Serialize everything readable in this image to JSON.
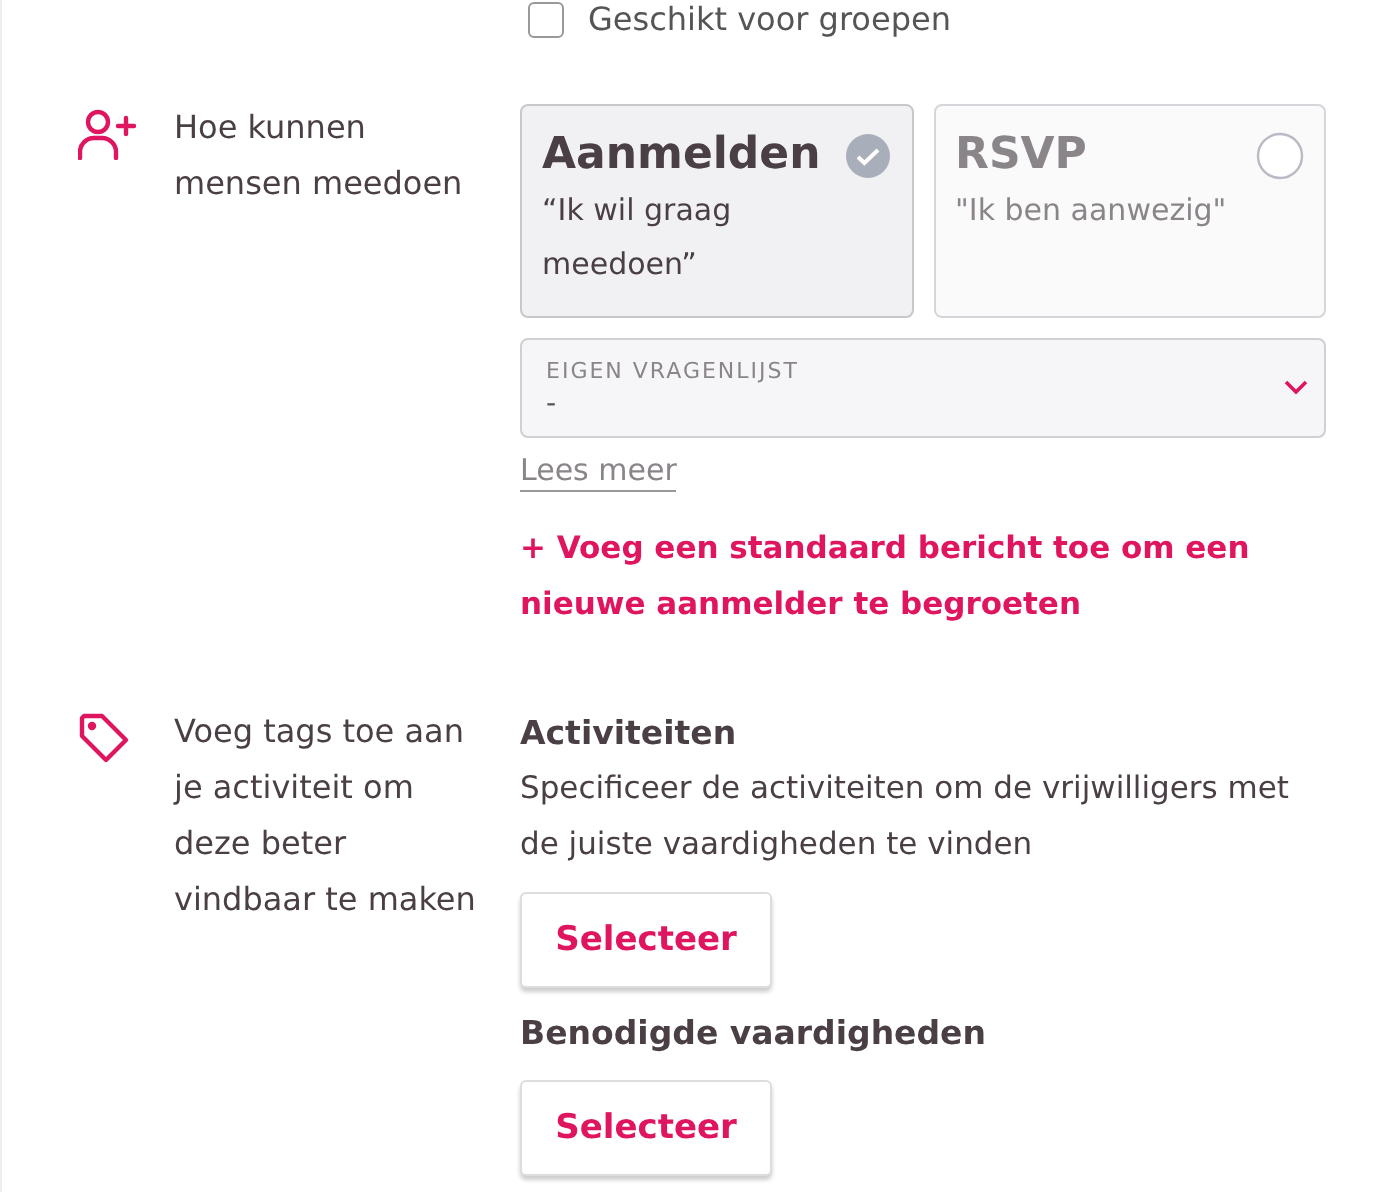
{
  "group_option": {
    "label": "Geschikt voor groepen",
    "checked": false
  },
  "join_section": {
    "label": "Hoe kunnen mensen meedoen",
    "options": [
      {
        "title": "Aanmelden",
        "subtitle": "“Ik wil graag meedoen”",
        "selected": true
      },
      {
        "title": "RSVP",
        "subtitle": "\"Ik ben aanwezig\"",
        "selected": false
      }
    ],
    "questionnaire": {
      "label": "EIGEN VRAGENLIJST",
      "value": "-"
    },
    "read_more": "Lees meer",
    "add_message": "+ Voeg een standaard bericht toe om een nieuwe aanmelder te begroeten"
  },
  "tags_section": {
    "label": "Voeg tags toe aan je activiteit om deze beter vindbaar te maken",
    "groups": [
      {
        "title": "Activiteiten",
        "description": "Specificeer de activiteiten om de vrijwilligers met de juiste vaardigheden te vinden",
        "button": "Selecteer"
      },
      {
        "title": "Benodigde vaardigheden",
        "button": "Selecteer"
      }
    ]
  }
}
